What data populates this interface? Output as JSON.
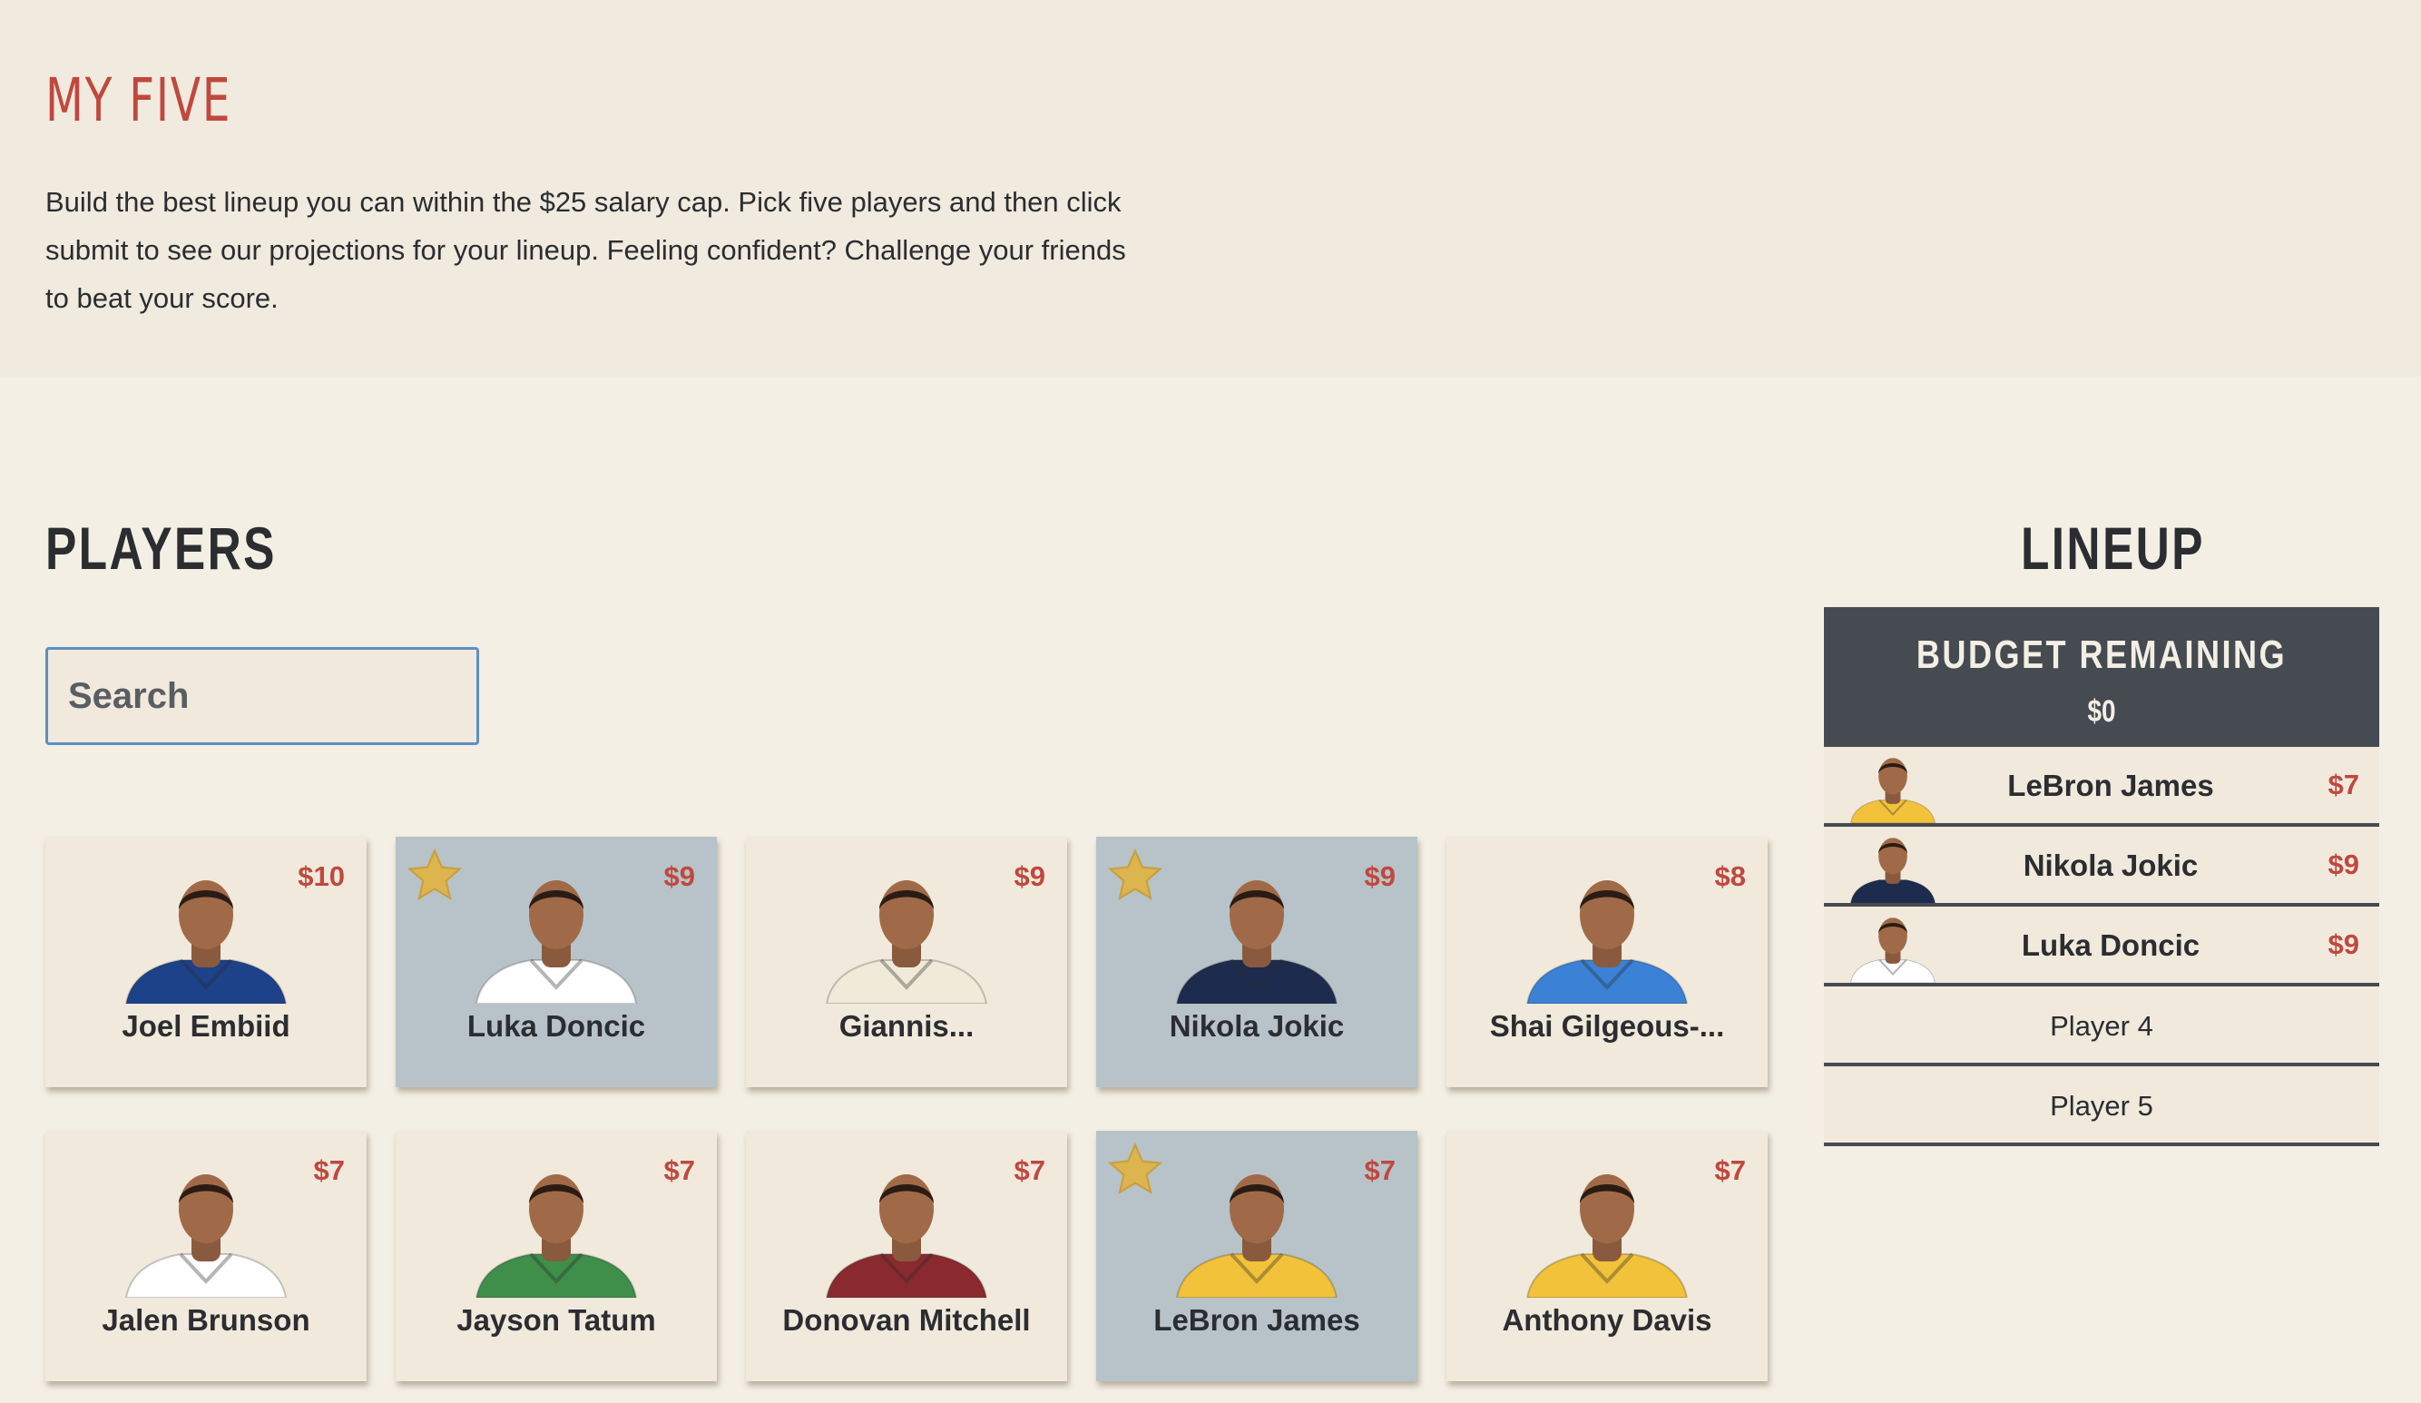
{
  "hero": {
    "title": "MY FIVE",
    "description": "Build the best lineup you can within the $25 salary cap. Pick five players and then click submit to see our projections for your lineup. Feeling confident? Challenge your friends to beat your score."
  },
  "players_section": {
    "title": "PLAYERS",
    "search_placeholder": "Search"
  },
  "players": [
    {
      "name": "Joel Embiid",
      "price": "$10",
      "selected": false,
      "jersey": "#1d428a"
    },
    {
      "name": "Luka Doncic",
      "price": "$9",
      "selected": true,
      "jersey": "#ffffff"
    },
    {
      "name": "Giannis...",
      "price": "$9",
      "selected": false,
      "jersey": "#f0ebd8"
    },
    {
      "name": "Nikola Jokic",
      "price": "$9",
      "selected": true,
      "jersey": "#1d2b4f"
    },
    {
      "name": "Shai Gilgeous-...",
      "price": "$8",
      "selected": false,
      "jersey": "#3b82d6"
    },
    {
      "name": "Jalen Brunson",
      "price": "$7",
      "selected": false,
      "jersey": "#ffffff"
    },
    {
      "name": "Jayson Tatum",
      "price": "$7",
      "selected": false,
      "jersey": "#3f8f4a"
    },
    {
      "name": "Donovan Mitchell",
      "price": "$7",
      "selected": false,
      "jersey": "#8a2a2e"
    },
    {
      "name": "LeBron James",
      "price": "$7",
      "selected": true,
      "jersey": "#f2c23a"
    },
    {
      "name": "Anthony Davis",
      "price": "$7",
      "selected": false,
      "jersey": "#f2c23a"
    }
  ],
  "lineup": {
    "title": "LINEUP",
    "budget_label": "BUDGET REMAINING",
    "budget_value": "$0",
    "slots": [
      {
        "name": "LeBron James",
        "price": "$7",
        "filled": true,
        "jersey": "#f2c23a"
      },
      {
        "name": "Nikola Jokic",
        "price": "$9",
        "filled": true,
        "jersey": "#1d2b4f"
      },
      {
        "name": "Luka Doncic",
        "price": "$9",
        "filled": true,
        "jersey": "#ffffff"
      },
      {
        "name": "Player 4",
        "price": "",
        "filled": false
      },
      {
        "name": "Player 5",
        "price": "",
        "filled": false
      }
    ]
  },
  "colors": {
    "accent": "#c0483f",
    "dark": "#464a51",
    "card_bg": "#f0e9dc",
    "card_selected_bg": "#b7c3c9",
    "star": "#dcb54e",
    "search_border": "#5b8fc4"
  }
}
